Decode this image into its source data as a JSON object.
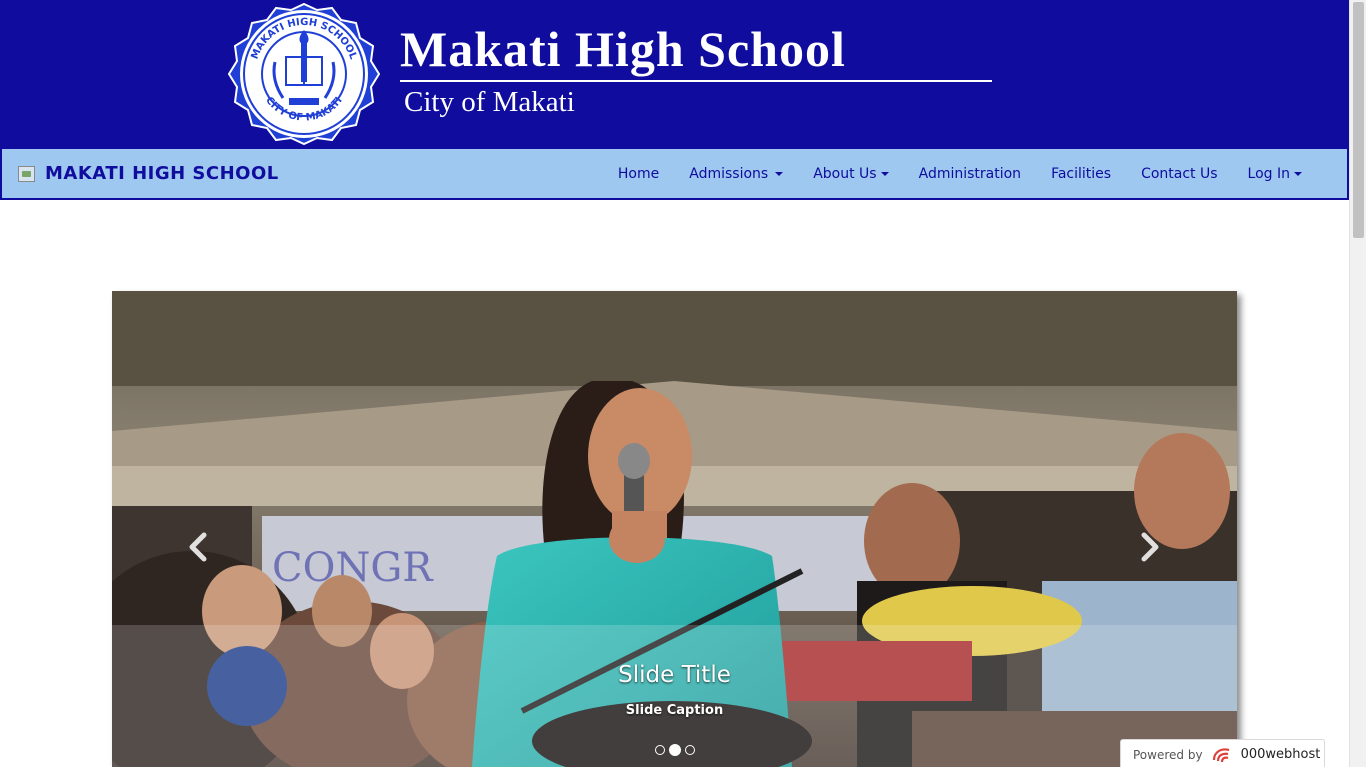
{
  "banner": {
    "title": "Makati High School",
    "subtitle": "City of Makati",
    "seal_icon": "school-seal-logo",
    "colors": {
      "background": "#0f0c9e",
      "text": "#ffffff"
    }
  },
  "navbar": {
    "brand": "MAKATI HIGH SCHOOL",
    "items": [
      {
        "label": "Home",
        "dropdown": false
      },
      {
        "label": "Admissions",
        "dropdown": true
      },
      {
        "label": "About Us",
        "dropdown": true
      },
      {
        "label": "Administration",
        "dropdown": false
      },
      {
        "label": "Facilities",
        "dropdown": false
      },
      {
        "label": "Contact Us",
        "dropdown": false
      },
      {
        "label": "Log In",
        "dropdown": true
      }
    ],
    "colors": {
      "background": "#9ec8f0",
      "text": "#0f0c9e"
    }
  },
  "carousel": {
    "slide_title": "Slide Title",
    "slide_caption": "Slide Caption",
    "slide_count": 3,
    "active_slide": 2,
    "prev_icon": "chevron-left-icon",
    "next_icon": "chevron-right-icon"
  },
  "footer_badge": {
    "powered_label": "Powered by",
    "host_name": "000webhost",
    "host_logo_icon": "000webhost-logo"
  }
}
